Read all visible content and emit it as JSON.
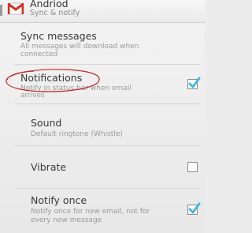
{
  "actionbar": {
    "title": "Andriod",
    "subtitle": "Sync & notify",
    "app_icon": "gmail-envelope-icon",
    "up_icon": "up-chevron-icon"
  },
  "preferences": [
    {
      "id": "sync-messages",
      "title": "Sync messages",
      "summary_lines": [
        "All messages will download when",
        "connected"
      ]
    },
    {
      "id": "notifications",
      "title": "Notifications",
      "summary_lines": [
        "Notify in status bar when email",
        "arrives"
      ],
      "checked": true,
      "annotated": true
    },
    {
      "id": "sound",
      "title": "Sound",
      "summary_lines": [
        "Default ringtone (Whistle)"
      ]
    },
    {
      "id": "vibrate",
      "title": "Vibrate",
      "checked": false
    },
    {
      "id": "notify-once",
      "title": "Notify once",
      "summary_lines": [
        "Notify once for new email, not for",
        "every new message"
      ],
      "checked": true
    }
  ],
  "colors": {
    "check_accent": "#33b5e5",
    "annotation": "#c62828",
    "gmail_red": "#d93025"
  }
}
